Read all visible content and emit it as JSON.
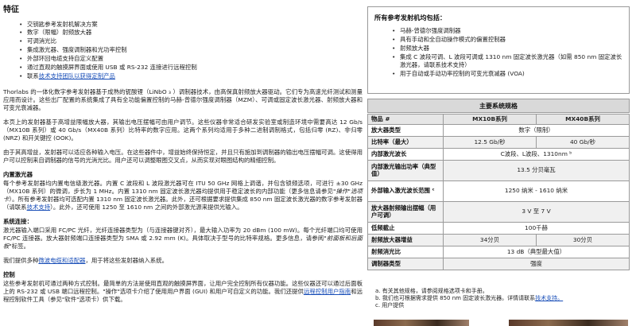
{
  "left": {
    "features_title": "特征",
    "features": [
      "交钥匙参考发射机解决方案",
      "数字（限幅）射频放大器",
      "可调消光比",
      "集成激光器、强度调制器和光功率控制",
      "外部环回电缆支持自定义配置",
      "通过直观的触摸屏界面或使用 USB 或 RS-232 连接进行远程控制"
    ],
    "features_last_prefix": "联系",
    "features_last_link": "技术支持团队以获得定制产品",
    "intro_1": "Thorlabs 的一体化数字参考发射器基于成熟的铌酸锂（LiNbO ₃ ）调制器技术，由高保真射频放大器驱动。它们专为高速光纤测试和测量应用而设计。这些出厂配置的系统集成了具有全功能偏置控制的马赫-曾德尔强度调制器（MZM）、可调或固定波长激光器、射频放大器和可变光衰减器。",
    "intro_2": "本页上的发射器基于高增益限幅放大器，其输出电压摆幅可由用户调节。这些仪器非常适合研发实验室或制造环境中需要高达 12 Gb/s（MX10B 系列）或 40 Gb/s（MX40B 系列）比特率的数字应用。这两个系列均适用于多种二进制调制格式，包括归零 (RZ)、非归零 (NRZ) 和开关键控 (OOK)。",
    "intro_3": "由于其高增益，发射器可以适应各种输入电压。在这些器件中，增益始终保持恒定，并且只有施加到调制器的输出电压摆幅可调。这使得用户可以控制来自调制器的信号的光消光比。用户还可以调整眼图交叉点，从而实现对眼图结构的精细控制。",
    "laser_title": "内置激光器",
    "laser_text": "每个参考发射器均内置电信级激光器。内置 C 波段和 L 波段激光器可在 ITU 50 GHz 网格上调谐，并包含锁频选项，可进行 ±30 GHz（MX10B 系列）的微调，步长为 1 MHz。内置 1310 nm 固定波长激光器均提供用于稳定波长的内部功能（更多信息请参见",
    "laser_text_ital": "\"操作\"选项卡",
    "laser_text_2": "）。所有参考发射器均可选配内置 1310 nm 固定波长激光器。此外，还可根据要求提供集成 850 nm 固定波长激光器的数字参考发射器（请联系",
    "laser_link": "技术支持",
    "laser_text_3": "）。此外，还可使用 1250 至 1610 nm 之间的外部激光源来提供光输入。",
    "conn_title": "系统连接：",
    "conn_text": "激光器输入端口采用 FC/PC 光纤，光纤连接器类型为（与连接器键对齐），最大输入功率为 20 dBm (100 mW)。每个光纤端口均可使用 FC/PC 连接器。放大器射频端口连接器类型为 SMA 或 2.92 mm (K)。具体取决于型号的比特率规格。更多信息，请参阅",
    "conn_ital": "\"前面板和后面板\"",
    "conn_text_2": "标签。",
    "kit_prefix": "我们提供多种",
    "kit_link": "微波电缆和适配器",
    "kit_suffix": "，用于将这些发射器纳入系统。",
    "ctrl_title": "控制",
    "ctrl_text": "这些参考发射机可通过两种方式控制。最简单的方法是使用直观的触摸屏界面，让用户完全控制所有仪器功能。这些仪器还可以通过后面板上的 RS-232 或 USB 端口远程控制。\"操作\"选项卡介绍了使用用户界面 (GUI) 和用户可自定义的功能。我们还提供",
    "ctrl_link": "远程控制用户指南",
    "ctrl_text_2": "和远程控制软件工具（参见\"软件\"选项卡）供下载。"
  },
  "right_box": {
    "title": "所有参考发射机均包括：",
    "items": [
      "马赫-曾德尔强度调制器",
      "具有手动和全自动操作模式的偏置控制器",
      "射频放大器",
      "集成 C 波段可调、L 波段可调或 1310 nm 固定波长激光器（如需 850 nm 固定波长激光器，请联系技术支持）",
      "用于自动或手动功率控制的可变光衰减器 (VOA)"
    ],
    "link_item_index": 3
  },
  "spec": {
    "title": "主要系统规格",
    "col_label": "物品 #",
    "cols": [
      "MX10B系列",
      "MX40B系列"
    ],
    "rows": [
      {
        "label": "放大器类型",
        "merged": "数字（限制）"
      },
      {
        "label": "比特率（最大）",
        "values": [
          "12.5 Gb/秒",
          "40 Gb/秒"
        ]
      },
      {
        "label": "内部激光波长",
        "merged": "C波段、L波段、1310nm ᵇ"
      },
      {
        "label": "内部激光输出功率（典型值）",
        "merged": "13.5 分贝毫瓦"
      },
      {
        "label": "外部输入激光波长范围 ᶜ",
        "merged": "1250 纳米 - 1610 纳米"
      },
      {
        "label": "放大器射频输出摆幅（用户可调）",
        "merged": "3 V 至 7 V"
      },
      {
        "label": "低频截止",
        "merged": "100千赫"
      },
      {
        "label": "射频放大器增益",
        "values": [
          "34分贝",
          "30分贝"
        ]
      },
      {
        "label": "射频消光比",
        "merged": "13 dB（典型最大值）"
      },
      {
        "label": "调制器类型",
        "merged": "强度"
      }
    ]
  },
  "notes": {
    "a": "a. 有关其他规格，请参阅规格选项卡和手册。",
    "b_prefix": "b. 我们也可根据需求提供 850 nm 固定波长激光器。详情请联系",
    "b_link": "技术支持。",
    "c": "c. 用户提供"
  }
}
